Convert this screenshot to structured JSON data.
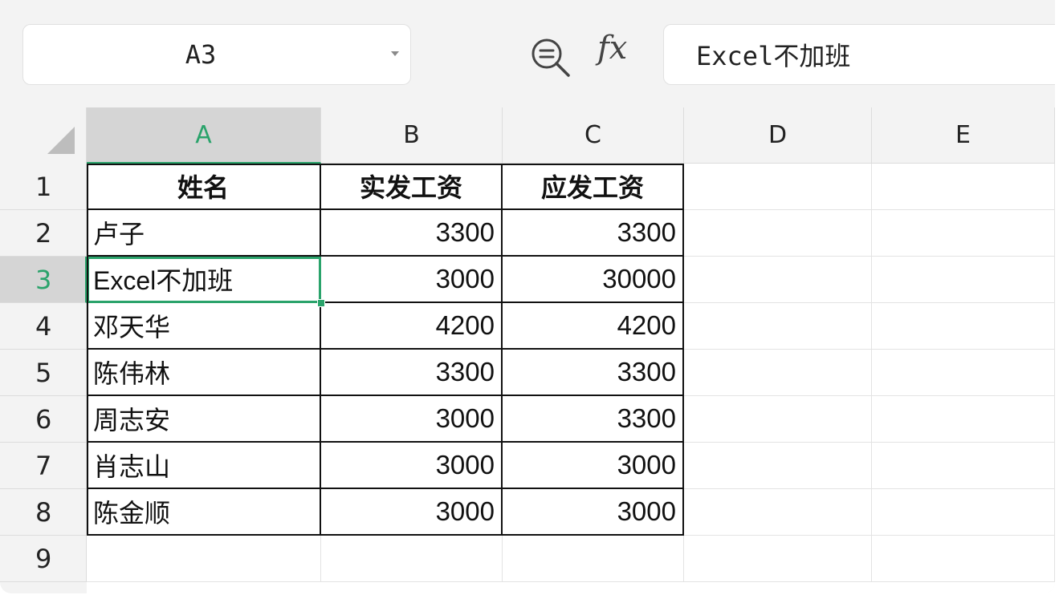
{
  "formula_bar": {
    "cell_reference": "A3",
    "formula_value": "Excel不加班",
    "fx_label": "fx"
  },
  "columns": [
    "A",
    "B",
    "C",
    "D",
    "E"
  ],
  "rows": [
    "1",
    "2",
    "3",
    "4",
    "5",
    "6",
    "7",
    "8",
    "9"
  ],
  "active_cell": {
    "column": "A",
    "row": "3"
  },
  "table": {
    "headers": [
      "姓名",
      "实发工资",
      "应发工资"
    ],
    "records": [
      [
        "卢子",
        "3300",
        "3300"
      ],
      [
        "Excel不加班",
        "3000",
        "30000"
      ],
      [
        "邓天华",
        "4200",
        "4200"
      ],
      [
        "陈伟林",
        "3300",
        "3300"
      ],
      [
        "周志安",
        "3000",
        "3300"
      ],
      [
        "肖志山",
        "3000",
        "3000"
      ],
      [
        "陈金顺",
        "3000",
        "3000"
      ]
    ]
  },
  "colors": {
    "selection": "#2aa36b",
    "header_bg": "#f3f3f3",
    "active_header_bg": "#d5d5d5"
  }
}
